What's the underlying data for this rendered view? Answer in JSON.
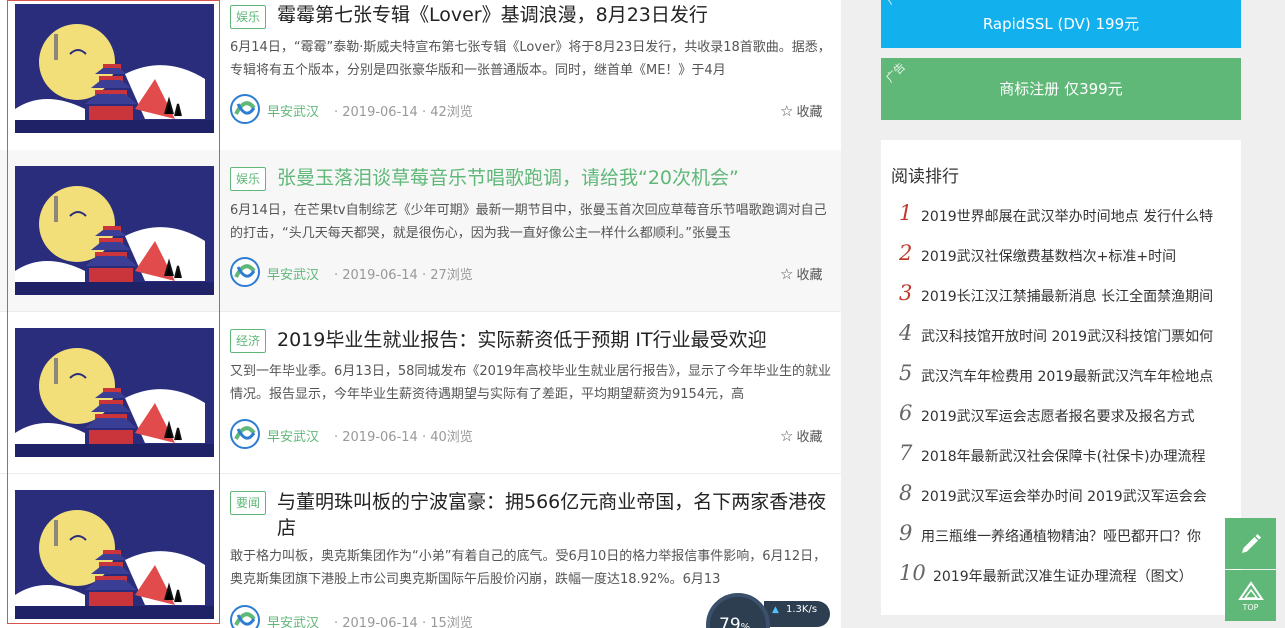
{
  "articles": [
    {
      "tag": "娱乐",
      "title": "霉霉第七张专辑《Lover》基调浪漫，8月23日发行",
      "excerpt": "6月14日，“霉霉”泰勒·斯威夫特宣布第七张专辑《Lover》将于8月23日发行，共收录18首歌曲。据悉，专辑将有五个版本，分别是四张豪华版和一张普通版本。同时，继首单《ME！》于4月",
      "source": "早安武汉",
      "date": "· 2019-06-14 · 42浏览",
      "fav": "收藏"
    },
    {
      "tag": "娱乐",
      "title": "张曼玉落泪谈草莓音乐节唱歌跑调，请给我“20次机会”",
      "excerpt": "6月14日，在芒果tv自制综艺《少年可期》最新一期节目中，张曼玉首次回应草莓音乐节唱歌跑调对自己的打击，“头几天每天都哭，就是很伤心，因为我一直好像公主一样什么都顺利。”张曼玉",
      "source": "早安武汉",
      "date": "· 2019-06-14 · 27浏览",
      "fav": "收藏"
    },
    {
      "tag": "经济",
      "title": "2019毕业生就业报告：实际薪资低于预期 IT行业最受欢迎",
      "excerpt": "又到一年毕业季。6月13日，58同城发布《2019年高校毕业生就业居行报告》，显示了今年毕业生的就业情况。报告显示，今年毕业生薪资待遇期望与实际有了差距，平均期望薪资为9154元，高",
      "source": "早安武汉",
      "date": "· 2019-06-14 · 40浏览",
      "fav": "收藏"
    },
    {
      "tag": "要闻",
      "title": "与董明珠叫板的宁波富豪：拥566亿元商业帝国，名下两家香港夜店",
      "excerpt": "敢于格力叫板，奥克斯集团作为“小弟”有着自己的底气。受6月10日的格力举报信事件影响，6月12日，奥克斯集团旗下港股上市公司奥克斯国际午后股价闪崩，跌幅一度达18.92%。6月13",
      "source": "早安武汉",
      "date": "· 2019-06-14 · 15浏览",
      "fav": "收藏"
    }
  ],
  "ads": {
    "ssl": "RapidSSL (DV) 199元",
    "trademark": "商标注册 仅399元",
    "label": "广告"
  },
  "ranking": {
    "title": "阅读排行",
    "items": [
      {
        "num": "1",
        "text": "2019世界邮展在武汉举办时间地点 发行什么特"
      },
      {
        "num": "2",
        "text": "2019武汉社保缴费基数档次+标准+时间"
      },
      {
        "num": "3",
        "text": "2019长江汉江禁捕最新消息 长江全面禁渔期间"
      },
      {
        "num": "4",
        "text": "武汉科技馆开放时间 2019武汉科技馆门票如何"
      },
      {
        "num": "5",
        "text": "武汉汽车年检费用 2019最新武汉汽车年检地点"
      },
      {
        "num": "6",
        "text": "2019武汉军运会志愿者报名要求及报名方式"
      },
      {
        "num": "7",
        "text": "2018年最新武汉社会保障卡(社保卡)办理流程"
      },
      {
        "num": "8",
        "text": "2019武汉军运会举办时间 2019武汉军运会会"
      },
      {
        "num": "9",
        "text": "用三瓶维一养络通植物精油？哑巴都开口？你"
      },
      {
        "num": "10",
        "text": "2019年最新武汉准生证办理流程（图文）"
      }
    ]
  },
  "float_buttons": {
    "top_label": "TOP"
  },
  "speed_widget": {
    "percent": "79",
    "percent_sign": "%",
    "rate": "1.3K/s"
  },
  "colors": {
    "accent_green": "#5fb878",
    "ad_blue": "#13b0ee",
    "rank_top_red": "#c0392b"
  }
}
